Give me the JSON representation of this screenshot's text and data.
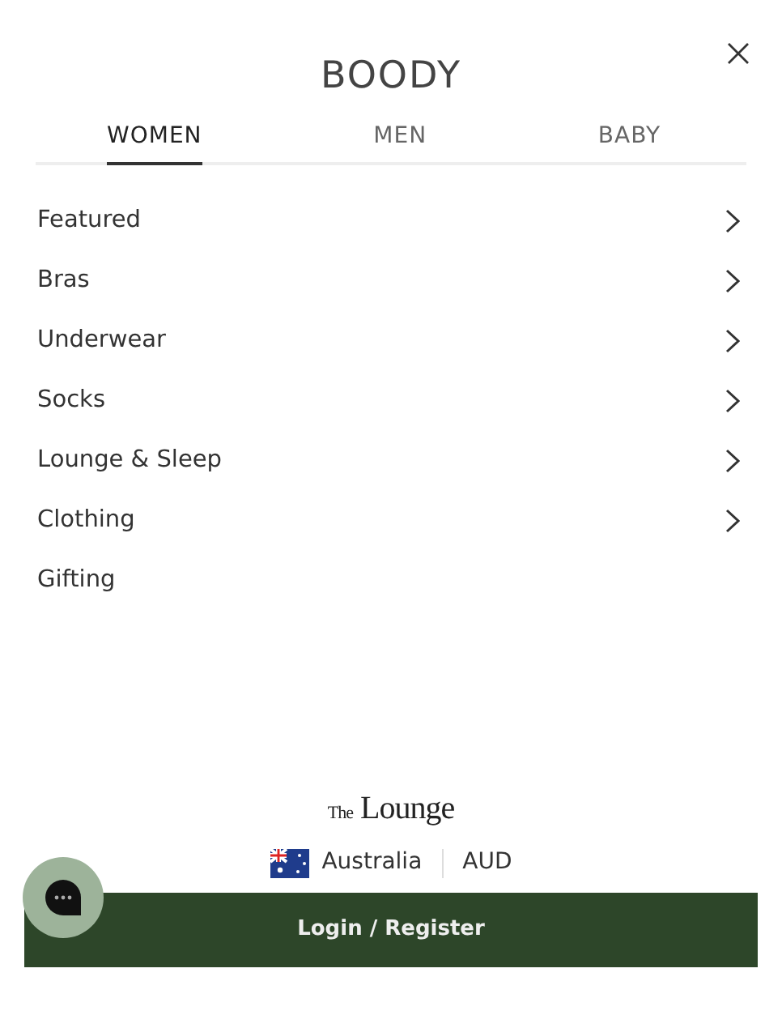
{
  "header": {
    "logo": "BOODY"
  },
  "tabs": [
    {
      "label": "WOMEN",
      "selected": true
    },
    {
      "label": "MEN",
      "selected": false
    },
    {
      "label": "BABY",
      "selected": false
    }
  ],
  "menu": [
    {
      "label": "Featured",
      "has_children": true
    },
    {
      "label": "Bras",
      "has_children": true
    },
    {
      "label": "Underwear",
      "has_children": true
    },
    {
      "label": "Socks",
      "has_children": true
    },
    {
      "label": "Lounge & Sleep",
      "has_children": true
    },
    {
      "label": "Clothing",
      "has_children": true
    },
    {
      "label": "Gifting",
      "has_children": false
    }
  ],
  "footer": {
    "lounge_logo": {
      "prefix": "The",
      "name": "Lounge"
    },
    "country": "Australia",
    "currency": "AUD",
    "login_button": "Login / Register"
  }
}
